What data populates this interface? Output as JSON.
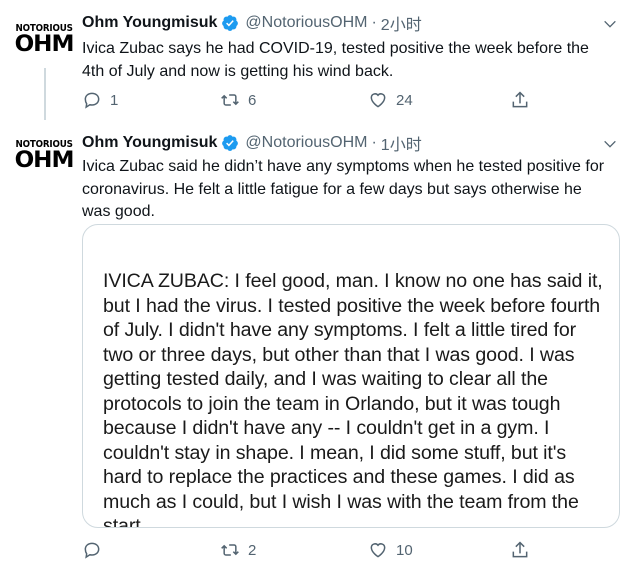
{
  "tweets": [
    {
      "avatar": {
        "line1": "NOTORIOUS",
        "line2": "OHM"
      },
      "name": "Ohm Youngmisuk",
      "handle": "@NotoriousOHM",
      "separator": "·",
      "time": "2小时",
      "text": "Ivica Zubac says he had COVID-19, tested positive the week before the 4th of July and now is getting his wind back.",
      "actions": {
        "reply": "1",
        "retweet": "6",
        "like": "24"
      }
    },
    {
      "avatar": {
        "line1": "NOTORIOUS",
        "line2": "OHM"
      },
      "name": "Ohm Youngmisuk",
      "handle": "@NotoriousOHM",
      "separator": "·",
      "time": "1小时",
      "text": "Ivica Zubac said he didn’t have any symptoms when he tested positive for coronavirus. He felt a little fatigue for a few days but says otherwise he was good.",
      "image_text": "IVICA ZUBAC: I feel good, man. I know no one has said it, but I had the virus. I tested positive the week before fourth of July. I didn't have any symptoms. I felt a little tired for two or three days, but other than that I was good. I was getting tested daily, and I was waiting to clear all the protocols to join the team in Orlando, but it was tough because I didn't have any -- I couldn't get in a gym. I couldn't stay in shape. I mean, I did some stuff, but it's hard to replace the practices and these games. I did as much as I could, but I wish I was with the team from the start.",
      "actions": {
        "reply": "",
        "retweet": "2",
        "like": "10"
      }
    }
  ],
  "colors": {
    "verified": "#1d9bf0",
    "muted": "#536471",
    "border": "#cfd9de"
  },
  "icons": [
    "verified-badge-icon",
    "chevron-down-icon",
    "reply-icon",
    "retweet-icon",
    "like-icon",
    "share-icon"
  ]
}
